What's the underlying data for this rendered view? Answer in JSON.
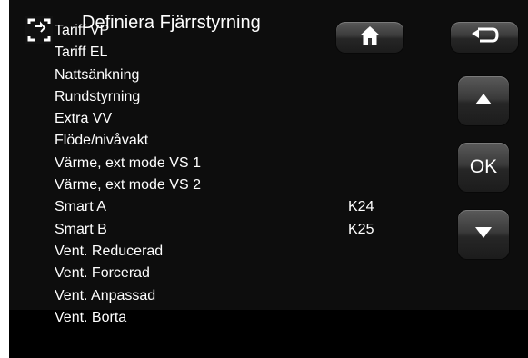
{
  "header": {
    "title": "Definiera Fjärrstyrning",
    "remote_icon": "remote-control-icon"
  },
  "menu": {
    "items": [
      {
        "label": "Tariff VP",
        "value": ""
      },
      {
        "label": "Tariff EL",
        "value": ""
      },
      {
        "label": "Nattsänkning",
        "value": ""
      },
      {
        "label": "Rundstyrning",
        "value": ""
      },
      {
        "label": "Extra VV",
        "value": ""
      },
      {
        "label": "Flöde/nivåvakt",
        "value": ""
      },
      {
        "label": "Värme, ext mode VS 1",
        "value": ""
      },
      {
        "label": "Värme, ext mode VS 2",
        "value": ""
      },
      {
        "label": "Smart A",
        "value": "K24"
      },
      {
        "label": "Smart B",
        "value": "K25"
      },
      {
        "label": "Vent. Reducerad",
        "value": ""
      },
      {
        "label": "Vent. Forcerad",
        "value": ""
      },
      {
        "label": "Vent. Anpassad",
        "value": ""
      },
      {
        "label": "Vent. Borta",
        "value": ""
      }
    ]
  },
  "buttons": {
    "home_icon": "home-icon",
    "back_icon": "back-arrow-icon",
    "up_icon": "triangle-up-icon",
    "ok_label": "OK",
    "down_icon": "triangle-down-icon"
  },
  "colors": {
    "background": "#0d0d0d",
    "text": "#ffffff",
    "button": "#3a3a3a"
  }
}
